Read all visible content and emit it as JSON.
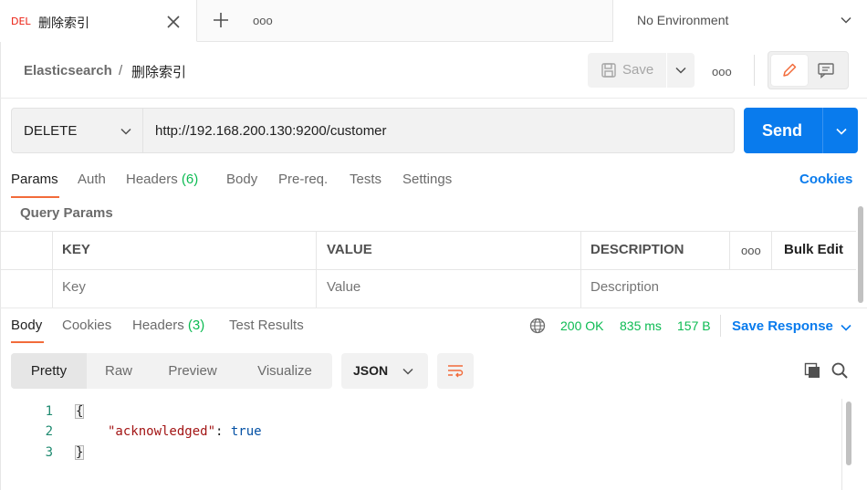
{
  "tab": {
    "method_badge": "DEL",
    "title": "删除索引",
    "more": "ooo"
  },
  "environment": {
    "selected": "No Environment"
  },
  "breadcrumb": {
    "parent": "Elasticsearch",
    "separator": "/",
    "current": "删除索引"
  },
  "toolbar": {
    "save_label": "Save",
    "more": "ooo"
  },
  "request": {
    "method": "DELETE",
    "url": "http://192.168.200.130:9200/customer",
    "send_label": "Send"
  },
  "request_tabs": {
    "params": "Params",
    "auth": "Auth",
    "headers": "Headers",
    "headers_count": "(6)",
    "body": "Body",
    "prereq": "Pre-req.",
    "tests": "Tests",
    "settings": "Settings",
    "cookies": "Cookies"
  },
  "query_params": {
    "title": "Query Params",
    "columns": {
      "key": "KEY",
      "value": "VALUE",
      "description": "DESCRIPTION",
      "more": "ooo",
      "bulk_edit": "Bulk Edit"
    },
    "placeholders": {
      "key": "Key",
      "value": "Value",
      "description": "Description"
    }
  },
  "response_tabs": {
    "body": "Body",
    "cookies": "Cookies",
    "headers": "Headers",
    "headers_count": "(3)",
    "test_results": "Test Results"
  },
  "response_status": {
    "status": "200 OK",
    "time": "835 ms",
    "size": "157 B",
    "save_response": "Save Response"
  },
  "view_modes": {
    "pretty": "Pretty",
    "raw": "Raw",
    "preview": "Preview",
    "visualize": "Visualize"
  },
  "format": {
    "selected": "JSON"
  },
  "code": {
    "line_numbers": [
      "1",
      "2",
      "3"
    ],
    "open_brace": "{",
    "key": "\"acknowledged\"",
    "colon": ": ",
    "value": "true",
    "close_brace": "}"
  },
  "colors": {
    "accent_orange": "#f26b3a",
    "send_blue": "#097bed",
    "status_green": "#0cbb52",
    "method_red": "#eb2013"
  }
}
